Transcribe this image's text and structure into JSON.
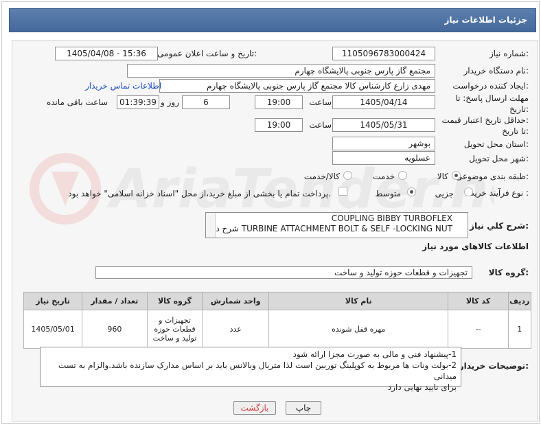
{
  "header": {
    "title": "جزئیات اطلاعات نیاز"
  },
  "fields": {
    "need_number_label": "شماره نیاز:",
    "need_number": "1105096783000424",
    "announce_label": "تاریخ و ساعت اعلان عمومی:",
    "announce_value": "1405/04/08 - 15:36",
    "buyer_label": "نام دستگاه خریدار:",
    "buyer_value": "مجتمع گاز پارس جنوبی  پالایشگاه چهارم",
    "creator_label": "ایجاد کننده درخواست:",
    "creator_value": "مهدی زارع کارشناس کالا مجتمع گاز پارس جنوبی  پالایشگاه چهارم",
    "contact_link": "اطلاعات تماس خریدار",
    "deadline_label_1": "مهلت ارسال پاسخ: تا",
    "deadline_label_2": "تاریخ:",
    "deadline_date": "1405/04/14",
    "time_label": "ساعت",
    "deadline_time": "19:00",
    "days_value": "6",
    "days_label": "روز و",
    "remaining_value": "01:39:39",
    "remaining_label": "ساعت باقی مانده",
    "validity_label_1": "حداقل تاریخ اعتبار قیمت:",
    "validity_label_2": "تا تاریخ:",
    "validity_date": "1405/05/31",
    "validity_time": "19:00",
    "province_label": "استان محل تحویل:",
    "province_value": "بوشهر",
    "city_label": "شهر محل تحویل:",
    "city_value": "عسلویه",
    "category_label": "طبقه بندی موضوعی:",
    "category_options": [
      "کالا",
      "خدمت",
      "کالا/خدمت"
    ],
    "process_label": "نوع فرآیند خرید :",
    "process_options": [
      "جزیی",
      "متوسط"
    ],
    "payment_note": "پرداخت تمام یا بخشی از مبلغ خرید،از محل \"اسناد خزانه اسلامی\" خواهد بود.",
    "general_desc_label": "شرح کلي نياز:",
    "general_desc_line1": "COUPLING BIBBY TURBOFLEX",
    "general_desc_line2": "TURBINE ATTACHMENT BOLT & SELF -LOCKING NUT شرح دقیق اقلام تقاضا به پیوست می باشد.",
    "goods_info_title": "اطلاعات کالاهای مورد نیاز",
    "goods_group_label": "گروه کالا:",
    "goods_group_value": "تجهیزات و قطعات حوزه تولید و ساخت"
  },
  "table": {
    "headers": [
      "ردیف",
      "کد کالا",
      "نام کالا",
      "واحد شمارش",
      "گروه کالا",
      "تعداد / مقدار",
      "تاریخ نیاز"
    ],
    "rows": [
      [
        "1",
        "--",
        "مهره قفل شونده",
        "عدد",
        "تجهیزات و قطعات حوزه تولید و ساخت",
        "960",
        "1405/05/01"
      ]
    ]
  },
  "notes": {
    "label": "توضیحات خریدار:",
    "line1": "1-پیشنهاد فنی و مالی به صورت مجزا ارائه شود",
    "line2": "2-بولت ونات ها مربوط به کوپلینگ  توربین است لذا متریال وبالانس باید بر اساس مدارک سازنده باشد.والزام به تست میدانی",
    "line3": "برای تایید نهایی دارد"
  },
  "buttons": {
    "print": "چاپ",
    "back": "بازگشت"
  },
  "watermark": "AriaTender.net",
  "colors": {
    "title_bar": "#4d6f9f",
    "link": "#1f4fbf",
    "back_text": "#d04040"
  }
}
